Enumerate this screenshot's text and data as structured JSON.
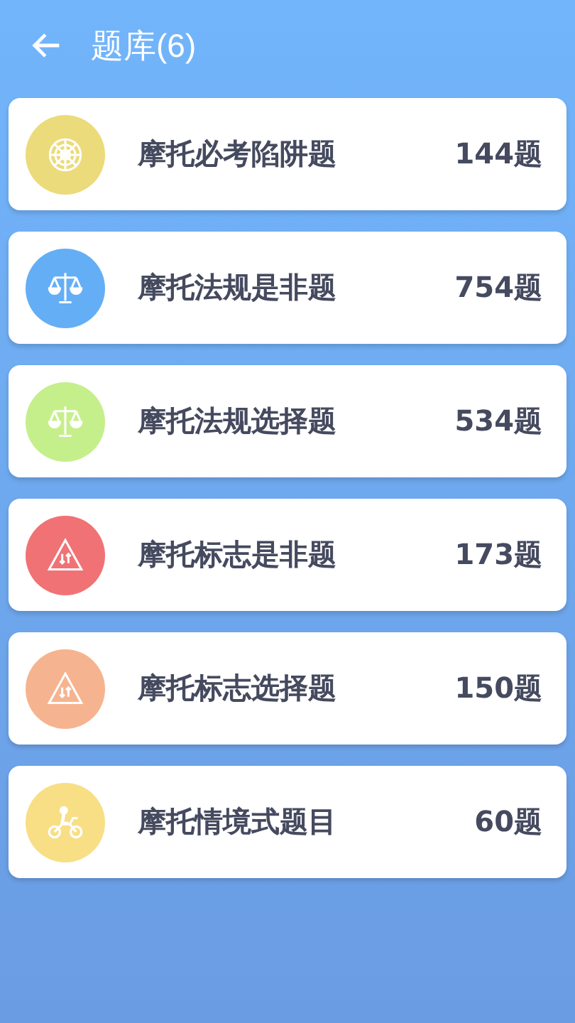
{
  "header": {
    "title": "题库(6)"
  },
  "categories": [
    {
      "name": "摩托必考陷阱题",
      "count": "144题",
      "kind": "web",
      "color": "#ebdb7a"
    },
    {
      "name": "摩托法规是非题",
      "count": "754题",
      "kind": "scale",
      "color": "#64aef5"
    },
    {
      "name": "摩托法规选择题",
      "count": "534题",
      "kind": "scale",
      "color": "#c5ef8b"
    },
    {
      "name": "摩托标志是非题",
      "count": "173题",
      "kind": "sign",
      "color": "#f07275"
    },
    {
      "name": "摩托标志选择题",
      "count": "150题",
      "kind": "sign",
      "color": "#f5b48f"
    },
    {
      "name": "摩托情境式题目",
      "count": "60题",
      "kind": "rider",
      "color": "#f8df85"
    }
  ]
}
